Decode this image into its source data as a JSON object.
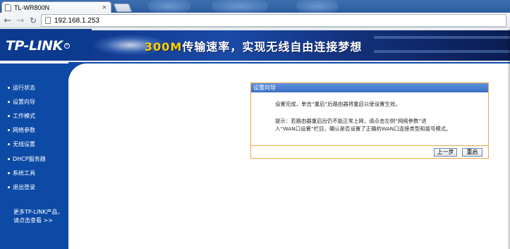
{
  "browser": {
    "tab_title": "TL-WR800N",
    "tab_close": "×",
    "url": "192.168.1.253",
    "icons": {
      "back": "arrow-left-icon",
      "forward": "arrow-right-icon",
      "reload": "reload-icon",
      "page": "page-icon",
      "close": "close-icon"
    }
  },
  "header": {
    "logo": "TP-LINK",
    "logo_mark": "®",
    "slogan_accent": "300M",
    "slogan_rest": "传输速率，实现无线自由连接梦想"
  },
  "sidebar": {
    "items": [
      {
        "label": "运行状态"
      },
      {
        "label": "设置向导"
      },
      {
        "label": "工作模式"
      },
      {
        "label": "网络参数"
      },
      {
        "label": "无线设置"
      },
      {
        "label": "DHCP服务器"
      },
      {
        "label": "系统工具"
      },
      {
        "label": "退出登录"
      }
    ],
    "more_line1": "更多TP-LINK产品，",
    "more_line2": "请点击查看 >>"
  },
  "panel": {
    "title": "设置向导",
    "message1": "设置完成，单击“重启”后路由器将重启以使设置生效。",
    "message2_line1": "提示：若路由器重启后仍不能正常上网，请点击左侧“网络参数”进",
    "message2_line2": "入“WAN口设置”栏目，确认是否设置了正确的WAN口连接类型和拨号模式。",
    "prev_label": "上一步",
    "reboot_label": "重启"
  },
  "colors": {
    "sidebar_blue": "#0c4aa6",
    "panel_border": "#f3a64a",
    "panel_header": "#3b6fc4",
    "slogan_accent": "#ffd200"
  }
}
